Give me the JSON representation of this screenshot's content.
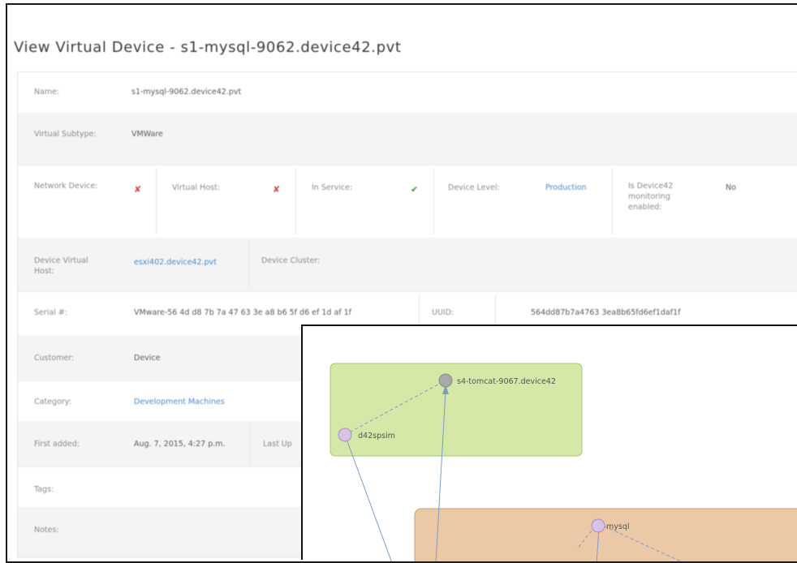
{
  "page": {
    "title": "View Virtual Device - s1-mysql-9062.device42.pvt"
  },
  "details": {
    "name_label": "Name:",
    "name_value": "s1-mysql-9062.device42.pvt",
    "virtual_subtype_label": "Virtual Subtype:",
    "virtual_subtype_value": "VMWare",
    "network_device_label": "Network Device:",
    "network_device_value": "✘",
    "virtual_host_label": "Virtual Host:",
    "virtual_host_value": "✘",
    "in_service_label": "In Service:",
    "in_service_value": "✔",
    "device_level_label": "Device Level:",
    "device_level_value": "Production",
    "monitoring_label": "Is Device42 monitoring enabled:",
    "monitoring_value": "No",
    "device_virtual_host_label": "Device Virtual Host:",
    "device_virtual_host_value": "esxi402.device42.pvt",
    "device_cluster_label": "Device Cluster:",
    "serial_label": "Serial #:",
    "serial_value": "VMware-56 4d d8 7b 7a 47 63 3e a8 b6 5f d6 ef 1d af 1f",
    "uuid_label": "UUID:",
    "uuid_value": "564dd87b7a4763 3ea8b65fd6ef1daf1f",
    "customer_label": "Customer:",
    "customer_value": "Device",
    "category_label": "Category:",
    "category_value": "Development Machines",
    "first_added_label": "First added:",
    "first_added_value": "Aug. 7, 2015, 4:27 p.m.",
    "last_updated_label": "Last Up",
    "tags_label": "Tags:",
    "notes_label": "Notes:"
  },
  "topology": {
    "nodes": {
      "tomcat": "s4-tomcat-9067.device42",
      "spsim": "d42spsim",
      "mysql": "mysql"
    },
    "colors": {
      "group_green_fill": "#d6e8a8",
      "group_green_border": "#a9c670",
      "group_orange_fill": "#ebc9a7",
      "group_orange_border": "#c9a07d",
      "node_gray": "#a9a9a9",
      "node_purple": "#d8c3e6",
      "edge": "#7d9cc8"
    }
  }
}
